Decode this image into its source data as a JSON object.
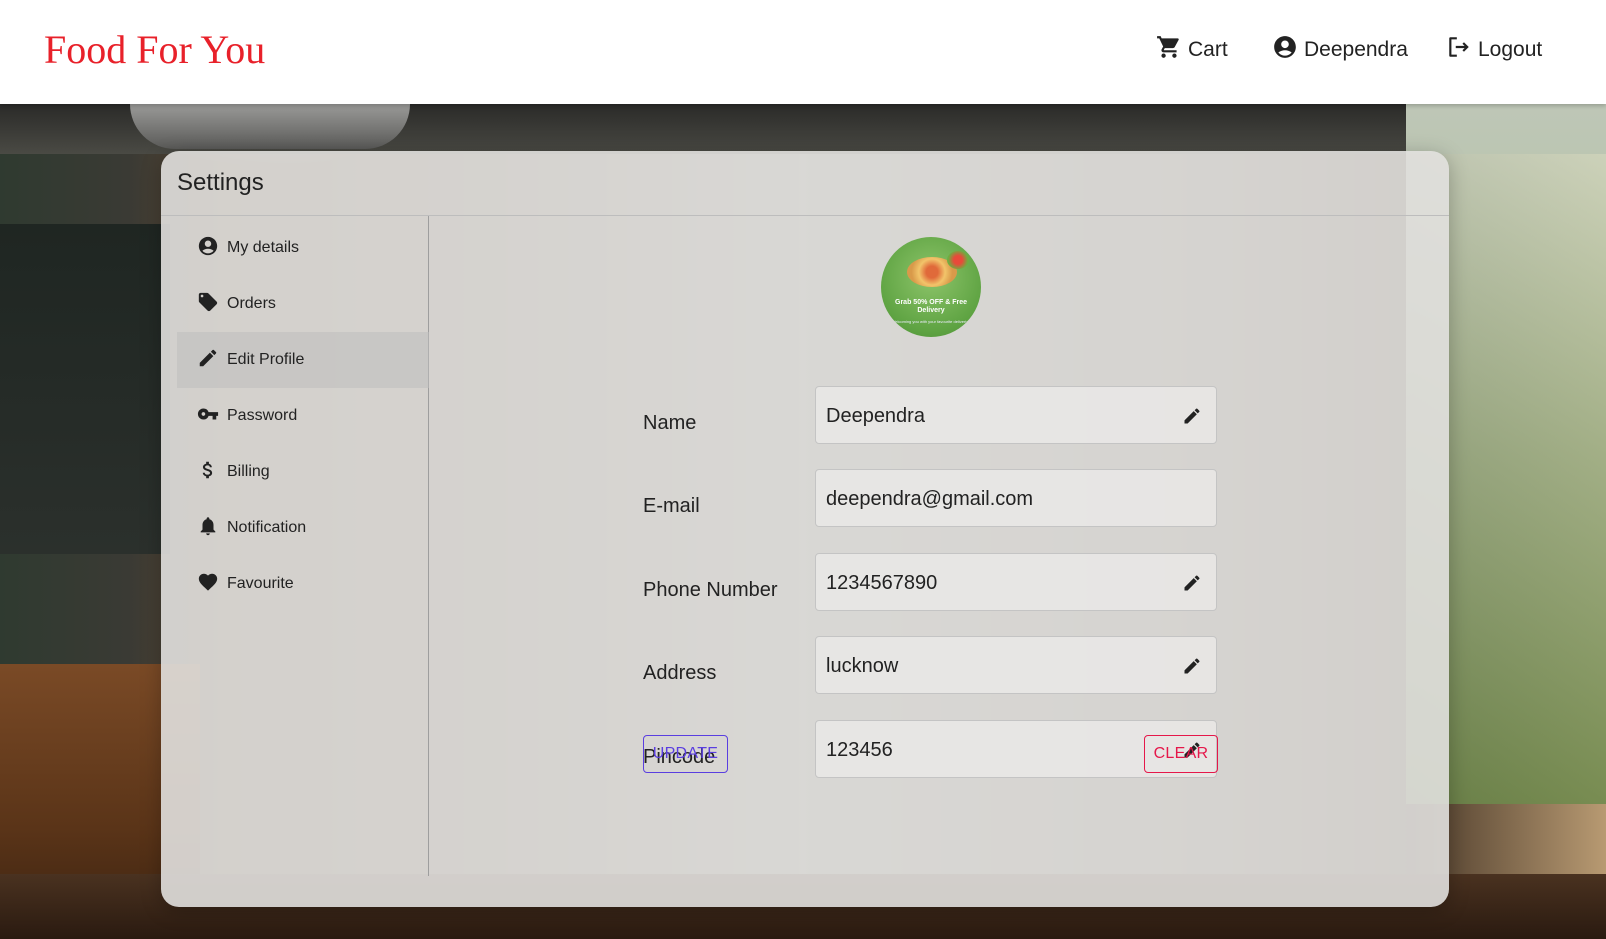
{
  "header": {
    "brand": "Food For You",
    "cart_label": "Cart",
    "user_label": "Deependra",
    "logout_label": "Logout"
  },
  "settings": {
    "title": "Settings",
    "menu": [
      {
        "label": "My details",
        "icon": "account-circle-icon"
      },
      {
        "label": "Orders",
        "icon": "tag-icon"
      },
      {
        "label": "Edit Profile",
        "icon": "pencil-icon",
        "active": true
      },
      {
        "label": "Password",
        "icon": "key-icon"
      },
      {
        "label": "Billing",
        "icon": "dollar-icon"
      },
      {
        "label": "Notification",
        "icon": "bell-icon"
      },
      {
        "label": "Favourite",
        "icon": "heart-icon"
      }
    ]
  },
  "profile": {
    "avatar_text": "Grab 50% OFF & Free Delivery",
    "avatar_subtext": "Welcoming you with your favourite deliveries",
    "fields": [
      {
        "label": "Name",
        "value": "Deependra",
        "editable": true
      },
      {
        "label": "E-mail",
        "value": "deependra@gmail.com",
        "editable": false
      },
      {
        "label": "Phone Number",
        "value": "1234567890",
        "editable": true
      },
      {
        "label": "Address",
        "value": "lucknow",
        "editable": true
      },
      {
        "label": "Pincode",
        "value": "123456",
        "editable": true
      }
    ],
    "update_label": "UPDATE",
    "clear_label": "CLEAR"
  },
  "colors": {
    "brand": "#e8212a",
    "update": "#5a3ee0",
    "clear": "#e5174a"
  }
}
